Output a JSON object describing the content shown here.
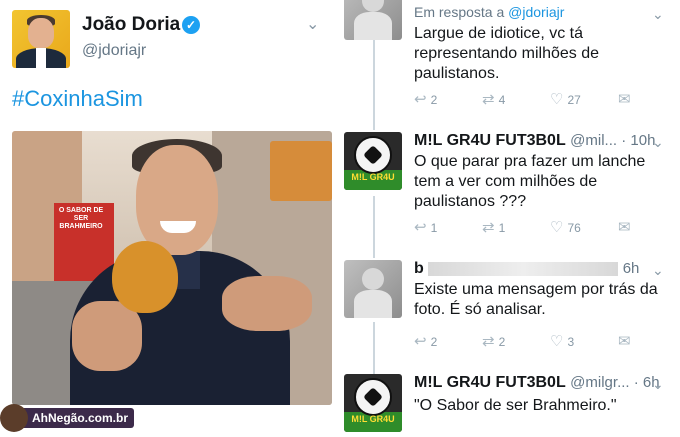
{
  "main_tweet": {
    "name": "João Doria",
    "handle": "@jdoriajr",
    "hashtag": "#CoxinhaSim",
    "photo_sign": "O SABOR DE SER BRAHMEIRO"
  },
  "watermark": "AhNegão.com.br",
  "replies": [
    {
      "reply_to_prefix": "Em resposta a",
      "reply_to_handle": "@jdoriajr",
      "text": "Largue de idiotice, vc tá representando milhões de paulistanos.",
      "replies": "2",
      "retweets": "4",
      "likes": "27"
    },
    {
      "name": "M!L GR4U FUT3B0L",
      "meta": "@mil... · 10h",
      "avatar_label": "M!L GR4U",
      "text": "O que parar pra fazer um lanche tem a ver com milhões de paulistanos ???",
      "replies": "1",
      "retweets": "1",
      "likes": "76"
    },
    {
      "name": "b",
      "meta": "6h",
      "text": "Existe uma mensagem por trás da foto. É só analisar.",
      "replies": "2",
      "retweets": "2",
      "likes": "3"
    },
    {
      "name": "M!L GR4U FUT3B0L",
      "meta": "@milgr... · 6h",
      "avatar_label": "M!L GR4U",
      "text": "\"O Sabor de ser Brahmeiro.\""
    }
  ],
  "icons": {
    "verified": "verified-badge-icon",
    "reply": "reply-icon",
    "retweet": "retweet-icon",
    "like": "heart-icon",
    "dm": "mail-icon",
    "chevron": "chevron-down-icon"
  },
  "colors": {
    "link": "#1b95e0",
    "muted": "#657786",
    "verified": "#1da1f2"
  }
}
